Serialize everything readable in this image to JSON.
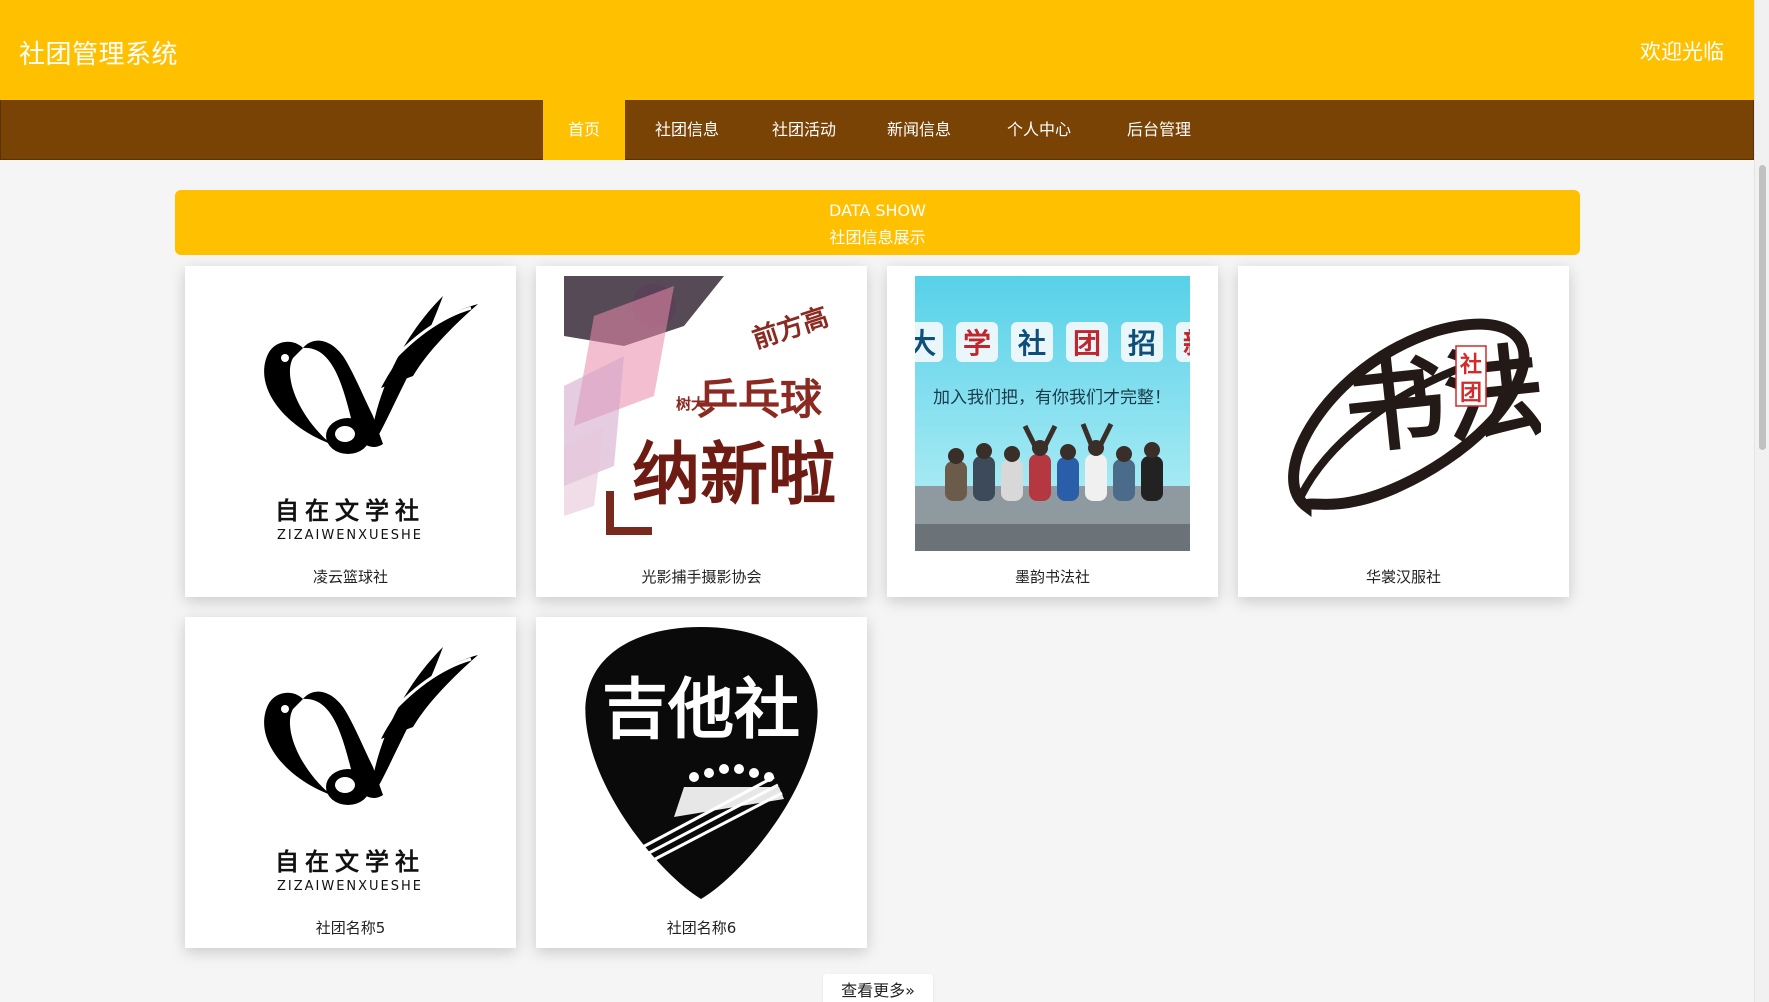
{
  "header": {
    "title": "社团管理系统",
    "welcome": "欢迎光临"
  },
  "nav": {
    "items": [
      {
        "label": "首页",
        "active": true
      },
      {
        "label": "社团信息",
        "active": false
      },
      {
        "label": "社团活动",
        "active": false
      },
      {
        "label": "新闻信息",
        "active": false
      },
      {
        "label": "个人中心",
        "active": false
      },
      {
        "label": "后台管理",
        "active": false
      }
    ]
  },
  "banner": {
    "title_en": "DATA SHOW",
    "title_cn": "社团信息展示"
  },
  "clubs": [
    {
      "name": "凌云篮球社",
      "image": "literature-logo",
      "logo_text": "自在文学社",
      "logo_sub": "ZIZAIWENXUESHE"
    },
    {
      "name": "光影捕手摄影协会",
      "image": "pingpong-poster",
      "poster_small": "前方高",
      "poster_side": "树大",
      "poster_main": "乒乓球",
      "poster_big": "纳新啦"
    },
    {
      "name": "墨韵书法社",
      "image": "recruit-photo",
      "recruit_chars": [
        "大",
        "学",
        "社",
        "团",
        "招",
        "新"
      ],
      "slogan": "加入我们把，有你我们才完整！"
    },
    {
      "name": "华裳汉服社",
      "image": "calligraphy-logo",
      "big_chars": "书法",
      "seal_chars": [
        "社",
        "团"
      ]
    },
    {
      "name": "社团名称5",
      "image": "literature-logo",
      "logo_text": "自在文学社",
      "logo_sub": "ZIZAIWENXUESHE"
    },
    {
      "name": "社团名称6",
      "image": "guitar-pick-logo",
      "pick_text": "吉他社"
    }
  ],
  "more_button": {
    "label": "查看更多»"
  },
  "colors": {
    "primary": "#FFC000",
    "nav_bg": "#7A4306",
    "page_bg": "#F5F5F5"
  }
}
